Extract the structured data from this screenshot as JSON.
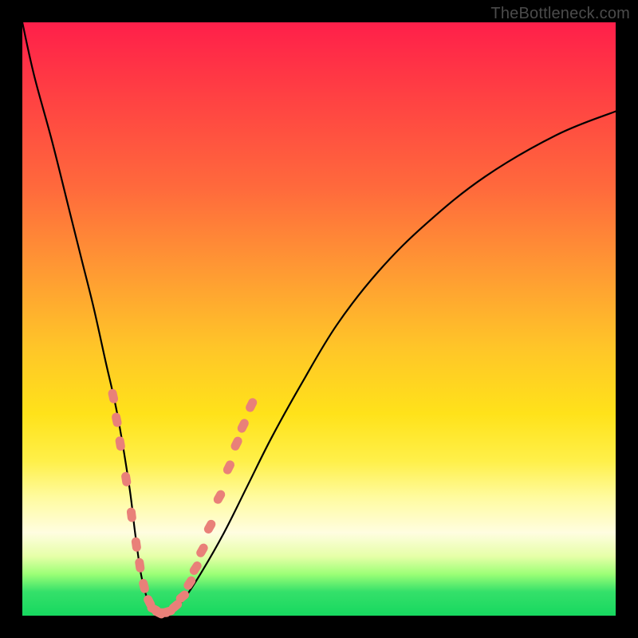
{
  "watermark": "TheBottleneck.com",
  "chart_data": {
    "type": "line",
    "title": "",
    "xlabel": "",
    "ylabel": "",
    "xlim": [
      0,
      100
    ],
    "ylim": [
      0,
      100
    ],
    "grid": false,
    "legend": false,
    "series": [
      {
        "name": "bottleneck-curve",
        "x": [
          0,
          2,
          5,
          8,
          10,
          12,
          14,
          16,
          18,
          19,
          20,
          21,
          22,
          23,
          24,
          25,
          27,
          30,
          34,
          38,
          42,
          47,
          53,
          60,
          68,
          78,
          90,
          100
        ],
        "y": [
          100,
          91,
          80,
          68,
          60,
          52,
          43,
          34,
          22,
          14,
          7,
          3,
          1,
          0.5,
          0.5,
          0.8,
          2.5,
          7,
          14,
          22,
          30,
          39,
          49,
          58,
          66,
          74,
          81,
          85
        ]
      }
    ],
    "markers": {
      "name": "highlighted-points",
      "points": [
        {
          "x": 15.3,
          "y": 37
        },
        {
          "x": 15.9,
          "y": 33
        },
        {
          "x": 16.5,
          "y": 29
        },
        {
          "x": 17.5,
          "y": 23
        },
        {
          "x": 18.4,
          "y": 17
        },
        {
          "x": 19.2,
          "y": 12
        },
        {
          "x": 19.8,
          "y": 8.5
        },
        {
          "x": 20.5,
          "y": 5
        },
        {
          "x": 21.4,
          "y": 2.3
        },
        {
          "x": 22.2,
          "y": 1.1
        },
        {
          "x": 23.0,
          "y": 0.5
        },
        {
          "x": 23.8,
          "y": 0.5
        },
        {
          "x": 24.6,
          "y": 0.7
        },
        {
          "x": 25.8,
          "y": 1.6
        },
        {
          "x": 27.0,
          "y": 3.2
        },
        {
          "x": 28.2,
          "y": 5.5
        },
        {
          "x": 29.2,
          "y": 8.0
        },
        {
          "x": 30.3,
          "y": 11.0
        },
        {
          "x": 31.6,
          "y": 15.0
        },
        {
          "x": 33.2,
          "y": 20.0
        },
        {
          "x": 34.8,
          "y": 25.0
        },
        {
          "x": 36.1,
          "y": 29.0
        },
        {
          "x": 37.2,
          "y": 32.0
        },
        {
          "x": 38.6,
          "y": 35.5
        }
      ]
    },
    "background_gradient": {
      "type": "vertical",
      "stops": [
        {
          "pos": 0.0,
          "color": "#ff1f4a"
        },
        {
          "pos": 0.28,
          "color": "#ff6a3c"
        },
        {
          "pos": 0.55,
          "color": "#ffc628"
        },
        {
          "pos": 0.8,
          "color": "#fffb9e"
        },
        {
          "pos": 0.93,
          "color": "#9cff76"
        },
        {
          "pos": 1.0,
          "color": "#17d85f"
        }
      ]
    }
  }
}
